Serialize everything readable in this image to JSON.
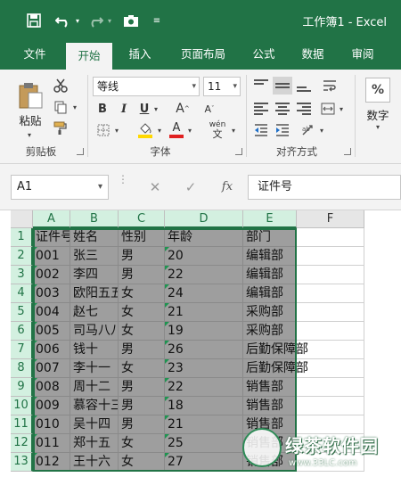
{
  "titlebar": {
    "title": "工作簿1 - Excel",
    "bg": "#217346"
  },
  "tabs": [
    "文件",
    "开始",
    "插入",
    "页面布局",
    "公式",
    "数据",
    "审阅"
  ],
  "active_tab": "开始",
  "ribbon": {
    "paste_label": "粘贴",
    "font_name": "等线",
    "font_size": "11",
    "bold": "B",
    "italic": "I",
    "underline": "U",
    "grow_font": "A",
    "shrink_font": "A",
    "font_color_glyph": "A",
    "wen": "wén",
    "number_label": "数字",
    "percent": "%",
    "groups": {
      "clipboard": "剪贴板",
      "font": "字体",
      "alignment": "对齐方式"
    }
  },
  "formulabar": {
    "name_box": "A1",
    "fx": "fx",
    "content": "证件号"
  },
  "columns": [
    "A",
    "B",
    "C",
    "D",
    "E",
    "F"
  ],
  "rows": [
    "1",
    "2",
    "3",
    "4",
    "5",
    "6",
    "7",
    "8",
    "9",
    "10",
    "11",
    "12",
    "13"
  ],
  "cells": [
    [
      "证件号",
      "姓名",
      "性别",
      "年龄",
      "部门"
    ],
    [
      "001",
      "张三",
      "男",
      "20",
      "编辑部"
    ],
    [
      "002",
      "李四",
      "男",
      "22",
      "编辑部"
    ],
    [
      "003",
      "欧阳五五",
      "女",
      "24",
      "编辑部"
    ],
    [
      "004",
      "赵七",
      "女",
      "21",
      "采购部"
    ],
    [
      "005",
      "司马八八",
      "女",
      "19",
      "采购部"
    ],
    [
      "006",
      "钱十",
      "男",
      "26",
      "后勤保障部"
    ],
    [
      "007",
      "李十一",
      "女",
      "23",
      "后勤保障部"
    ],
    [
      "008",
      "周十二",
      "男",
      "22",
      "销售部"
    ],
    [
      "009",
      "慕容十三",
      "男",
      "18",
      "销售部"
    ],
    [
      "010",
      "吴十四",
      "男",
      "21",
      "销售部"
    ],
    [
      "011",
      "郑十五",
      "女",
      "25",
      "销售部"
    ],
    [
      "012",
      "王十六",
      "女",
      "27",
      "销售部"
    ]
  ],
  "watermark": {
    "text": "绿茶软件园",
    "url": "www.33LC.com"
  }
}
